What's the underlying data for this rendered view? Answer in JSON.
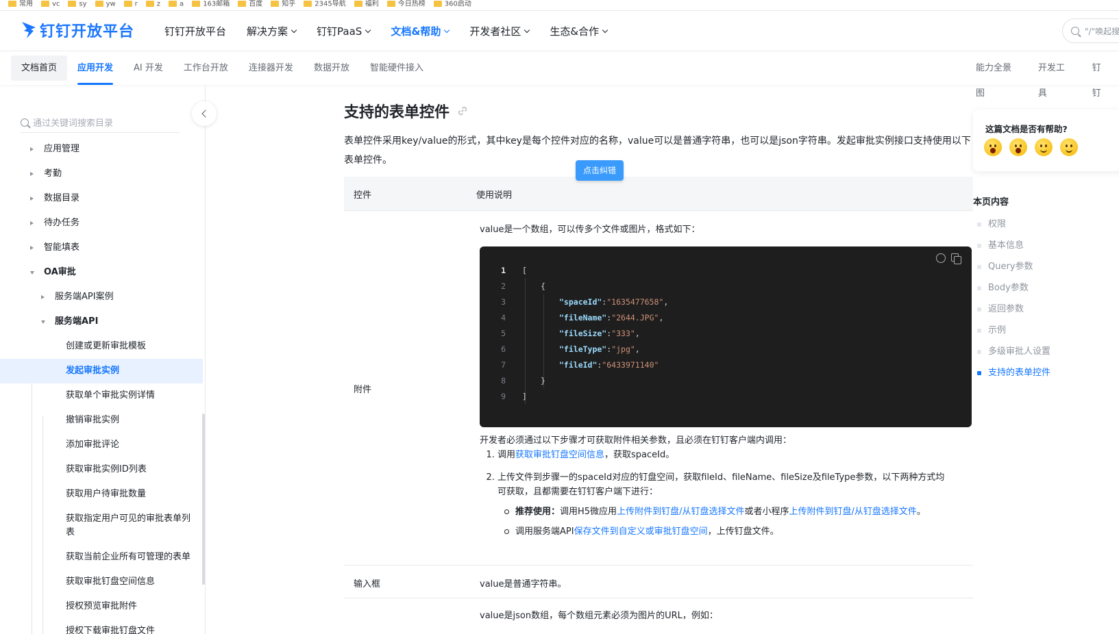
{
  "bookmarks": [
    "常用",
    "vc",
    "sy",
    "yw",
    "r",
    "z",
    "a",
    "163邮箱",
    "百度",
    "知乎",
    "2345导航",
    "福利",
    "今日热榜",
    "360启动"
  ],
  "topnav": {
    "logo_text": "钉钉开放平台",
    "items": [
      {
        "label": "钉钉开放平台",
        "dropdown": false
      },
      {
        "label": "解决方案",
        "dropdown": true
      },
      {
        "label": "钉钉PaaS",
        "dropdown": true
      },
      {
        "label": "文档&帮助",
        "dropdown": true,
        "active": true
      },
      {
        "label": "开发者社区",
        "dropdown": true
      },
      {
        "label": "生态&合作",
        "dropdown": true
      }
    ],
    "search_placeholder": "\"/\"唤起搜索"
  },
  "subnav": {
    "left": [
      "文档首页",
      "应用开发",
      "AI 开发",
      "工作台开放",
      "连接器开发",
      "数据开放",
      "智能硬件接入"
    ],
    "active_index": 1,
    "right": [
      "能力全景图",
      "开发工具",
      "钉钉"
    ]
  },
  "sidebar": {
    "search_placeholder": "通过关键词搜索目录",
    "tree": [
      {
        "label": "应用管理",
        "level": 0,
        "caret": "closed"
      },
      {
        "label": "考勤",
        "level": 0,
        "caret": "closed"
      },
      {
        "label": "数据目录",
        "level": 0,
        "caret": "closed"
      },
      {
        "label": "待办任务",
        "level": 0,
        "caret": "closed"
      },
      {
        "label": "智能填表",
        "level": 0,
        "caret": "closed"
      },
      {
        "label": "OA审批",
        "level": 0,
        "caret": "open",
        "bold": true
      },
      {
        "label": "服务端API案例",
        "level": 1,
        "caret": "closed"
      },
      {
        "label": "服务端API",
        "level": 1,
        "caret": "open",
        "bold": true
      },
      {
        "label": "创建或更新审批模板",
        "level": 2
      },
      {
        "label": "发起审批实例",
        "level": 2,
        "selected": true
      },
      {
        "label": "获取单个审批实例详情",
        "level": 2
      },
      {
        "label": "撤销审批实例",
        "level": 2
      },
      {
        "label": "添加审批评论",
        "level": 2
      },
      {
        "label": "获取审批实例ID列表",
        "level": 2
      },
      {
        "label": "获取用户待审批数量",
        "level": 2
      },
      {
        "label": "获取指定用户可见的审批表单列表",
        "level": 2,
        "tall": true
      },
      {
        "label": "获取当前企业所有可管理的表单",
        "level": 2
      },
      {
        "label": "获取审批钉盘空间信息",
        "level": 2
      },
      {
        "label": "授权预览审批附件",
        "level": 2
      },
      {
        "label": "授权下载审批钉盘文件",
        "level": 2
      }
    ]
  },
  "main": {
    "heading": "支持的表单控件",
    "intro": "表单控件采用key/value的形式，其中key是每个控件对应的名称，value可以是普通字符串，也可以是json字符串。发起审批实例接口支持使用以下表单控件。",
    "fix_button": "点击纠错",
    "table": {
      "col1": "控件",
      "col2": "使用说明",
      "attachment": {
        "name": "附件",
        "desc": "value是一个数组，可以传多个文件或图片，格式如下：",
        "code": [
          {
            "n": "1",
            "indent": 0,
            "text": "["
          },
          {
            "n": "2",
            "indent": 1,
            "text": "{"
          },
          {
            "n": "3",
            "indent": 2,
            "key": "\"spaceId\"",
            "val": "\"1635477658\"",
            "comma": true
          },
          {
            "n": "4",
            "indent": 2,
            "key": "\"fileName\"",
            "val": "\"2644.JPG\"",
            "comma": true
          },
          {
            "n": "5",
            "indent": 2,
            "key": "\"fileSize\"",
            "val": "\"333\"",
            "comma": true
          },
          {
            "n": "6",
            "indent": 2,
            "key": "\"fileType\"",
            "val": "\"jpg\"",
            "comma": true
          },
          {
            "n": "7",
            "indent": 2,
            "key": "\"fileId\"",
            "val": "\"6433971140\"",
            "comma": false
          },
          {
            "n": "8",
            "indent": 1,
            "text": "}"
          },
          {
            "n": "9",
            "indent": 0,
            "text": "]"
          }
        ],
        "steps_intro": "开发者必须通过以下步骤才可获取附件相关参数，且必须在钉钉客户端内调用：",
        "step1_pre": "调用",
        "step1_link": "获取审批钉盘空间信息",
        "step1_post": "，获取spaceId。",
        "step2": "上传文件到步骤一的spaceId对应的钉盘空间，获取fileId、fileName、fileSize及fileType参数，以下两种方式均可获取，且都需要在钉钉客户端下进行：",
        "sub1_bold": "推荐使用：",
        "sub1_pre": "调用H5微应用",
        "sub1_link1": "上传附件到钉盘/从钉盘选择文件",
        "sub1_mid": "或者小程序",
        "sub1_link2": "上传附件到钉盘/从钉盘选择文件",
        "sub1_post": "。",
        "sub2_pre": "调用服务端API",
        "sub2_link": "保存文件到自定义或审批钉盘空间",
        "sub2_post": "，上传钉盘文件。"
      },
      "input": {
        "name": "输入框",
        "desc": "value是普通字符串。"
      },
      "next_desc": "value是json数组，每个数组元素必须为图片的URL，例如："
    }
  },
  "right": {
    "help_title": "这篇文档是否有帮助?",
    "toc_title": "本页内容",
    "toc": [
      "权限",
      "基本信息",
      "Query参数",
      "Body参数",
      "返回参数",
      "示例",
      "多级审批人设置",
      "支持的表单控件"
    ],
    "toc_active": 7
  },
  "colors": {
    "accent": "#1677ff",
    "code_bg": "#1e1e1e"
  }
}
